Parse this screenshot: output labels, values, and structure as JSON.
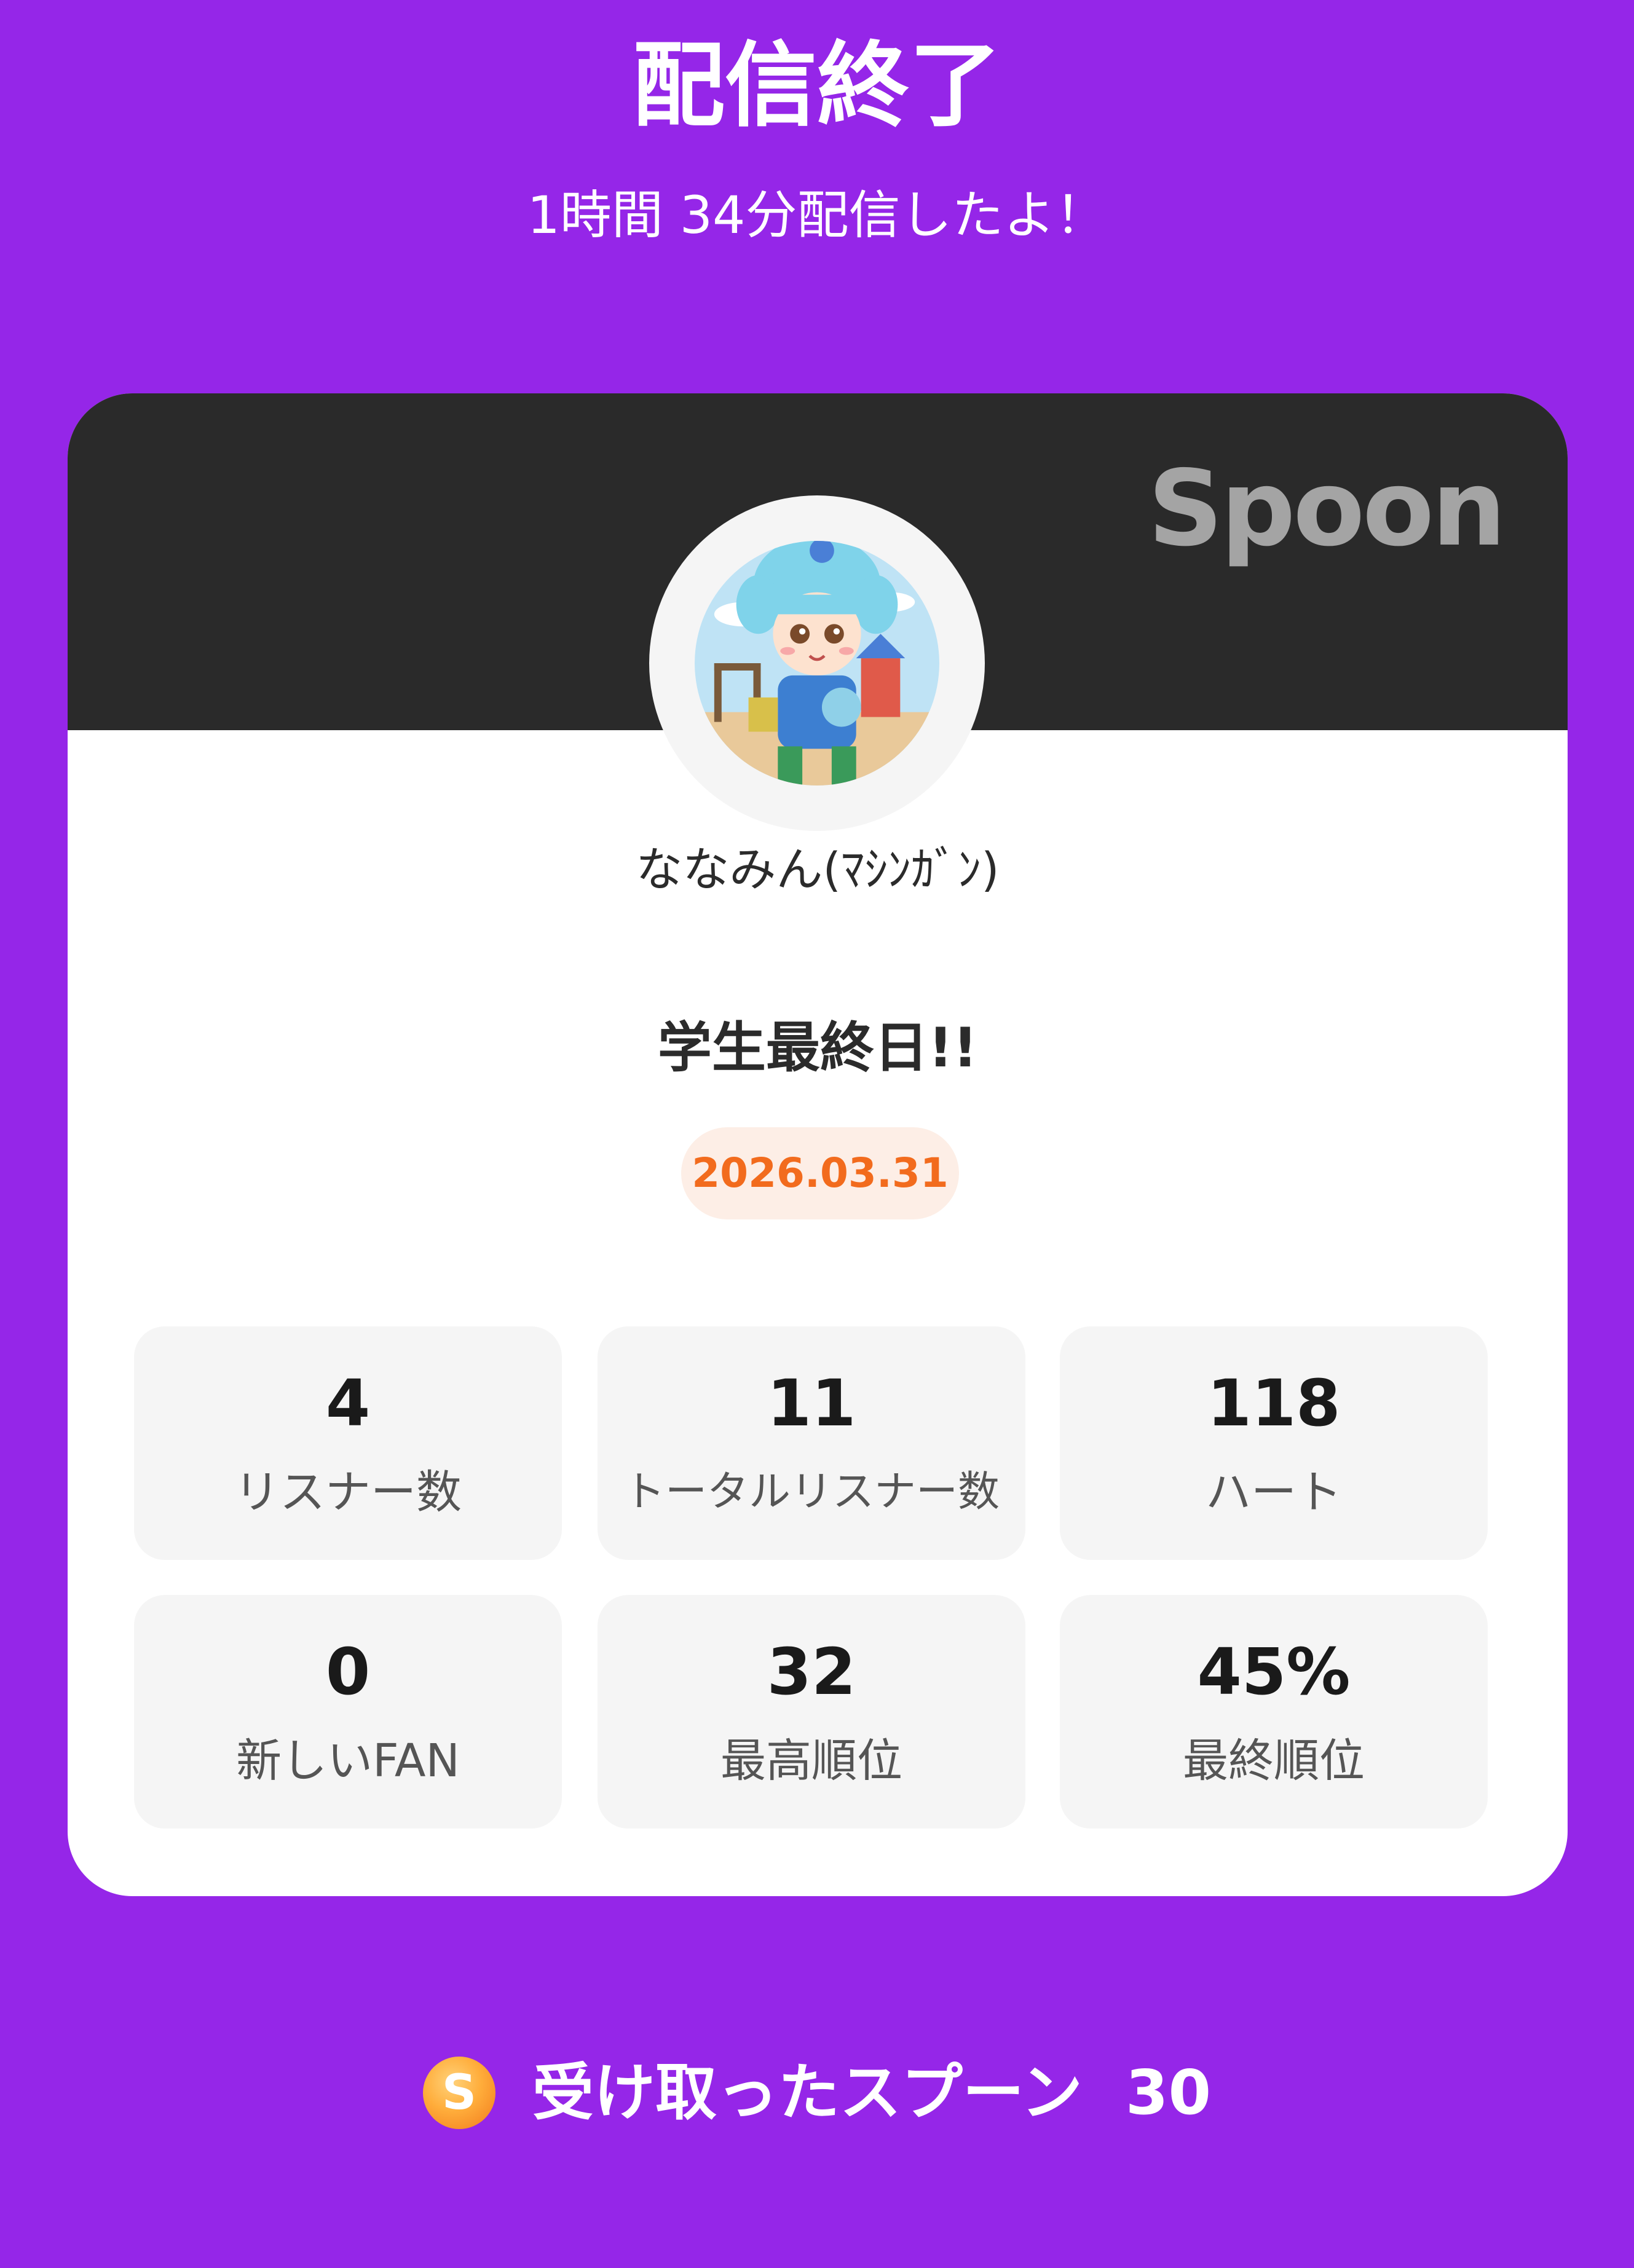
{
  "header": {
    "title": "配信終了",
    "subtitle": "1時間 34分配信したよ！"
  },
  "card": {
    "brand": "Spoon",
    "avatar_icon": "avatar-image",
    "username": "ななみん(ﾏｼﾝｶﾞﾝ)",
    "broadcast_title": "学生最終日!!",
    "date": "2026.03.31"
  },
  "stats": [
    {
      "value": "4",
      "label": "リスナー数"
    },
    {
      "value": "11",
      "label": "トータルリスナー数"
    },
    {
      "value": "118",
      "label": "ハート"
    },
    {
      "value": "0",
      "label": "新しいFAN"
    },
    {
      "value": "32",
      "label": "最高順位"
    },
    {
      "value": "45%",
      "label": "最終順位"
    }
  ],
  "spoons": {
    "icon": "spoon-coin-icon",
    "icon_letter": "S",
    "label": "受け取ったスプーン",
    "value": "30"
  },
  "colors": {
    "background": "#9526e8",
    "card_banner": "#2a2a2a",
    "date_text": "#f26b1d",
    "date_pill": "#fdeee6",
    "stat_box": "#f5f5f5"
  }
}
